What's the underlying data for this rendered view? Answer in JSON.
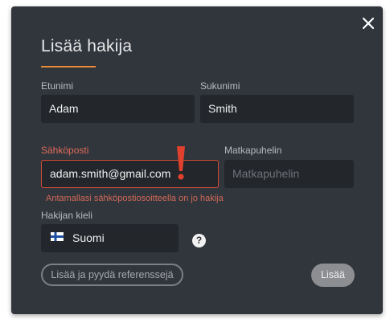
{
  "dialog": {
    "title": "Lisää hakija",
    "accent_color": "#e98a37",
    "close_icon": "close-icon"
  },
  "fields": {
    "first_name": {
      "label": "Etunimi",
      "value": "Adam"
    },
    "last_name": {
      "label": "Sukunimi",
      "value": "Smith"
    },
    "email": {
      "label": "Sähköposti",
      "value": "adam.smith@gmail.com",
      "error": "Antamallasi sähköpostiosoitteella on jo hakija",
      "error_color": "#d04a35"
    },
    "mobile": {
      "label": "Matkapuhelin",
      "placeholder": "Matkapuhelin"
    },
    "language": {
      "label": "Hakijan kieli",
      "selected": "Suomi",
      "flag_icon": "finland-flag-icon"
    }
  },
  "help_icon": "?",
  "buttons": {
    "add_and_request": "Lisää ja pyydä referenssejä",
    "add": "Lisää"
  }
}
